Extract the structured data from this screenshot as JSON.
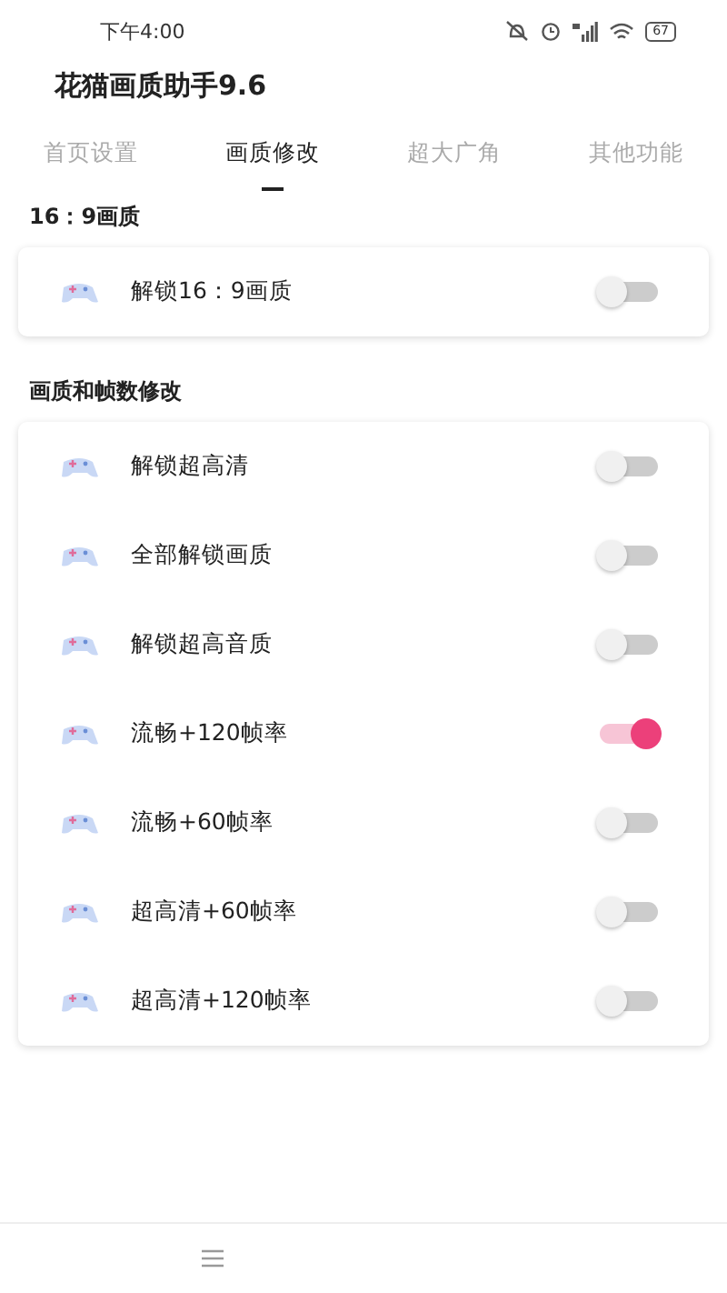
{
  "status_bar": {
    "time": "下午4:00",
    "battery": "67"
  },
  "app_title": "花猫画质助手9.6",
  "tabs": [
    {
      "label": "首页设置",
      "selected": false
    },
    {
      "label": "画质修改",
      "selected": true
    },
    {
      "label": "超大广角",
      "selected": false
    },
    {
      "label": "其他功能",
      "selected": false
    }
  ],
  "sections": [
    {
      "title": "16：9画质",
      "items": [
        {
          "label": "解锁16：9画质",
          "on": false
        }
      ]
    },
    {
      "title": "画质和帧数修改",
      "items": [
        {
          "label": "解锁超高清",
          "on": false
        },
        {
          "label": "全部解锁画质",
          "on": false
        },
        {
          "label": "解锁超高音质",
          "on": false
        },
        {
          "label": "流畅+120帧率",
          "on": true
        },
        {
          "label": "流畅+60帧率",
          "on": false
        },
        {
          "label": "超高清+60帧率",
          "on": false
        },
        {
          "label": "超高清+120帧率",
          "on": false
        }
      ]
    }
  ]
}
